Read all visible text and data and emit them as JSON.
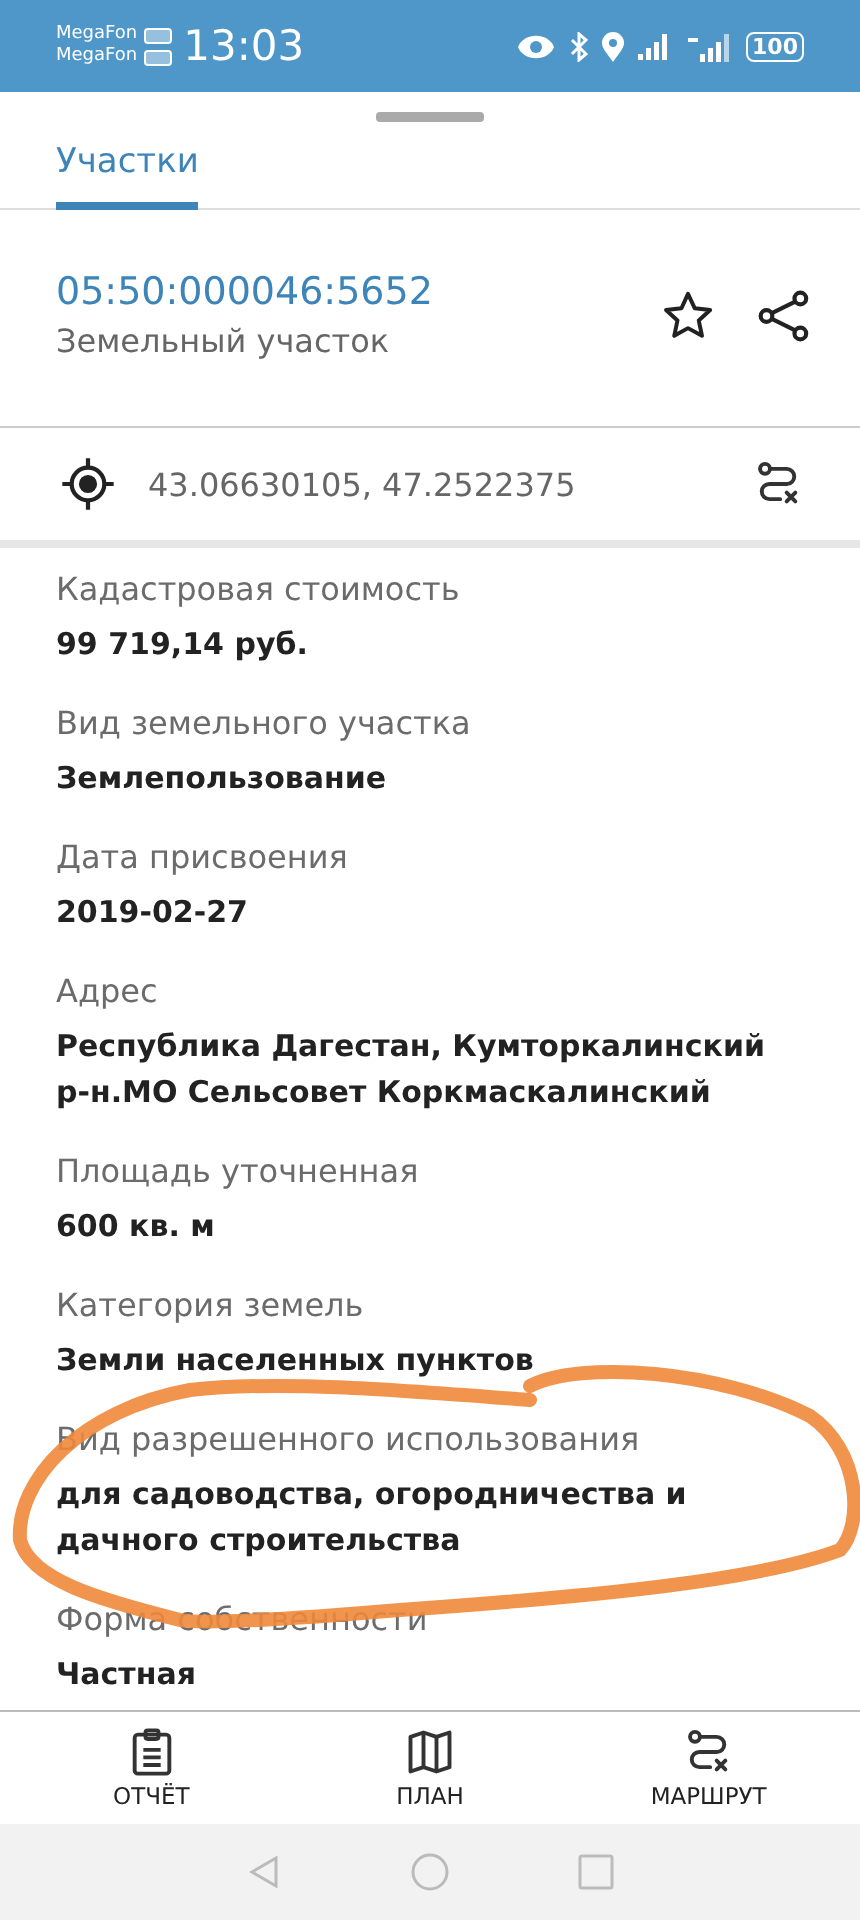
{
  "status_bar": {
    "carriers": [
      "MegaFon",
      "MegaFon"
    ],
    "time": "13:03",
    "battery": "100"
  },
  "tabs": [
    {
      "label": "Участки",
      "selected": true
    }
  ],
  "parcel": {
    "number": "05:50:000046:5652",
    "type": "Земельный участок",
    "coordinates": "43.06630105, 47.2522375"
  },
  "fields": [
    {
      "label": "Кадастровая стоимость",
      "value": "99 719,14 руб."
    },
    {
      "label": "Вид земельного участка",
      "value": "Землепользование"
    },
    {
      "label": "Дата присвоения",
      "value": "2019-02-27"
    },
    {
      "label": "Адрес",
      "value": "Республика Дагестан, Кумторкалинский р-н.МО Сельсовет Коркмаскалинский"
    },
    {
      "label": "Площадь уточненная",
      "value": "600 кв. м"
    },
    {
      "label": "Категория земель",
      "value": "Земли населенных пунктов"
    },
    {
      "label": "Вид разрешенного использования",
      "value": "для садоводства, огородничества и дачного строительства"
    },
    {
      "label": "Форма собственности",
      "value": "Частная"
    }
  ],
  "bottom_nav": [
    {
      "kind": "report",
      "label": "ОТЧЁТ"
    },
    {
      "kind": "plan",
      "label": "ПЛАН"
    },
    {
      "kind": "route",
      "label": "МАРШРУТ"
    }
  ]
}
